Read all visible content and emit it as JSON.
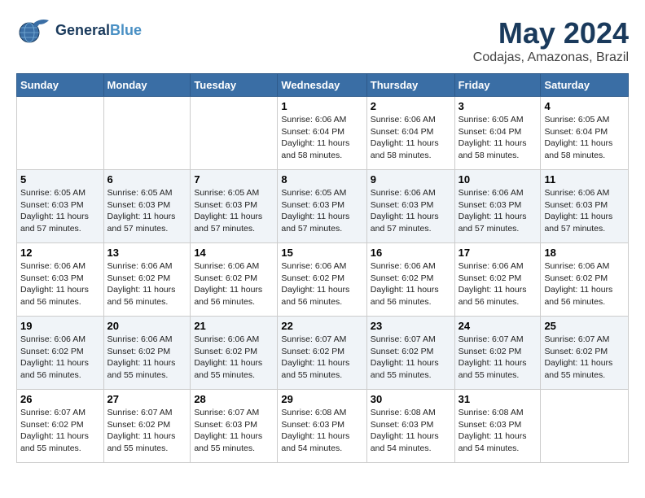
{
  "header": {
    "logo_line1": "General",
    "logo_line2": "Blue",
    "month": "May 2024",
    "location": "Codajas, Amazonas, Brazil"
  },
  "weekdays": [
    "Sunday",
    "Monday",
    "Tuesday",
    "Wednesday",
    "Thursday",
    "Friday",
    "Saturday"
  ],
  "weeks": [
    [
      {
        "day": "",
        "info": ""
      },
      {
        "day": "",
        "info": ""
      },
      {
        "day": "",
        "info": ""
      },
      {
        "day": "1",
        "info": "Sunrise: 6:06 AM\nSunset: 6:04 PM\nDaylight: 11 hours\nand 58 minutes."
      },
      {
        "day": "2",
        "info": "Sunrise: 6:06 AM\nSunset: 6:04 PM\nDaylight: 11 hours\nand 58 minutes."
      },
      {
        "day": "3",
        "info": "Sunrise: 6:05 AM\nSunset: 6:04 PM\nDaylight: 11 hours\nand 58 minutes."
      },
      {
        "day": "4",
        "info": "Sunrise: 6:05 AM\nSunset: 6:04 PM\nDaylight: 11 hours\nand 58 minutes."
      }
    ],
    [
      {
        "day": "5",
        "info": "Sunrise: 6:05 AM\nSunset: 6:03 PM\nDaylight: 11 hours\nand 57 minutes."
      },
      {
        "day": "6",
        "info": "Sunrise: 6:05 AM\nSunset: 6:03 PM\nDaylight: 11 hours\nand 57 minutes."
      },
      {
        "day": "7",
        "info": "Sunrise: 6:05 AM\nSunset: 6:03 PM\nDaylight: 11 hours\nand 57 minutes."
      },
      {
        "day": "8",
        "info": "Sunrise: 6:05 AM\nSunset: 6:03 PM\nDaylight: 11 hours\nand 57 minutes."
      },
      {
        "day": "9",
        "info": "Sunrise: 6:06 AM\nSunset: 6:03 PM\nDaylight: 11 hours\nand 57 minutes."
      },
      {
        "day": "10",
        "info": "Sunrise: 6:06 AM\nSunset: 6:03 PM\nDaylight: 11 hours\nand 57 minutes."
      },
      {
        "day": "11",
        "info": "Sunrise: 6:06 AM\nSunset: 6:03 PM\nDaylight: 11 hours\nand 57 minutes."
      }
    ],
    [
      {
        "day": "12",
        "info": "Sunrise: 6:06 AM\nSunset: 6:03 PM\nDaylight: 11 hours\nand 56 minutes."
      },
      {
        "day": "13",
        "info": "Sunrise: 6:06 AM\nSunset: 6:02 PM\nDaylight: 11 hours\nand 56 minutes."
      },
      {
        "day": "14",
        "info": "Sunrise: 6:06 AM\nSunset: 6:02 PM\nDaylight: 11 hours\nand 56 minutes."
      },
      {
        "day": "15",
        "info": "Sunrise: 6:06 AM\nSunset: 6:02 PM\nDaylight: 11 hours\nand 56 minutes."
      },
      {
        "day": "16",
        "info": "Sunrise: 6:06 AM\nSunset: 6:02 PM\nDaylight: 11 hours\nand 56 minutes."
      },
      {
        "day": "17",
        "info": "Sunrise: 6:06 AM\nSunset: 6:02 PM\nDaylight: 11 hours\nand 56 minutes."
      },
      {
        "day": "18",
        "info": "Sunrise: 6:06 AM\nSunset: 6:02 PM\nDaylight: 11 hours\nand 56 minutes."
      }
    ],
    [
      {
        "day": "19",
        "info": "Sunrise: 6:06 AM\nSunset: 6:02 PM\nDaylight: 11 hours\nand 56 minutes."
      },
      {
        "day": "20",
        "info": "Sunrise: 6:06 AM\nSunset: 6:02 PM\nDaylight: 11 hours\nand 55 minutes."
      },
      {
        "day": "21",
        "info": "Sunrise: 6:06 AM\nSunset: 6:02 PM\nDaylight: 11 hours\nand 55 minutes."
      },
      {
        "day": "22",
        "info": "Sunrise: 6:07 AM\nSunset: 6:02 PM\nDaylight: 11 hours\nand 55 minutes."
      },
      {
        "day": "23",
        "info": "Sunrise: 6:07 AM\nSunset: 6:02 PM\nDaylight: 11 hours\nand 55 minutes."
      },
      {
        "day": "24",
        "info": "Sunrise: 6:07 AM\nSunset: 6:02 PM\nDaylight: 11 hours\nand 55 minutes."
      },
      {
        "day": "25",
        "info": "Sunrise: 6:07 AM\nSunset: 6:02 PM\nDaylight: 11 hours\nand 55 minutes."
      }
    ],
    [
      {
        "day": "26",
        "info": "Sunrise: 6:07 AM\nSunset: 6:02 PM\nDaylight: 11 hours\nand 55 minutes."
      },
      {
        "day": "27",
        "info": "Sunrise: 6:07 AM\nSunset: 6:02 PM\nDaylight: 11 hours\nand 55 minutes."
      },
      {
        "day": "28",
        "info": "Sunrise: 6:07 AM\nSunset: 6:03 PM\nDaylight: 11 hours\nand 55 minutes."
      },
      {
        "day": "29",
        "info": "Sunrise: 6:08 AM\nSunset: 6:03 PM\nDaylight: 11 hours\nand 54 minutes."
      },
      {
        "day": "30",
        "info": "Sunrise: 6:08 AM\nSunset: 6:03 PM\nDaylight: 11 hours\nand 54 minutes."
      },
      {
        "day": "31",
        "info": "Sunrise: 6:08 AM\nSunset: 6:03 PM\nDaylight: 11 hours\nand 54 minutes."
      },
      {
        "day": "",
        "info": ""
      }
    ]
  ]
}
